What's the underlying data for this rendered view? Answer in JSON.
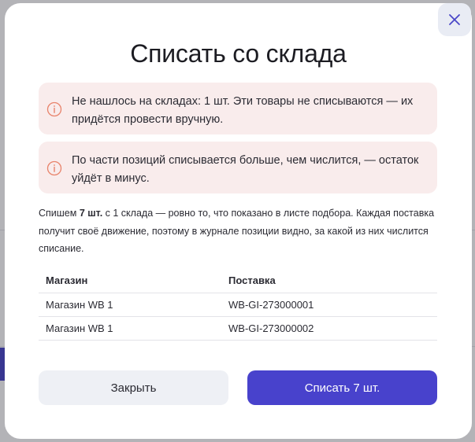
{
  "dialog": {
    "title": "Списать со склада",
    "alerts": [
      {
        "icon": "info-circle-icon",
        "text": "Не нашлось на складах: 1 шт. Эти товары не списываются — их придётся провести вручную."
      },
      {
        "icon": "info-circle-icon",
        "text": "По части позиций списывается больше, чем числится, — остаток уйдёт в минус."
      }
    ],
    "description": {
      "prefix": "Спишем ",
      "qty": "7 шт.",
      "rest": " с 1 склада — ровно то, что показано в листе подбора. Каждая поставка получит своё движение, поэтому в журнале позиции видно, за какой из них числится списание."
    },
    "table": {
      "columns": [
        "Магазин",
        "Поставка"
      ],
      "rows": [
        [
          "Магазин WB 1",
          "WB-GI-273000001"
        ],
        [
          "Магазин WB 1",
          "WB-GI-273000002"
        ]
      ]
    },
    "buttons": {
      "close_label": "Закрыть",
      "writeoff_label": "Списать 7 шт."
    },
    "close_icon": "close-icon"
  },
  "colors": {
    "accent": "#4842cc",
    "alert_bg": "#f9ecec",
    "alert_icon": "#e8836b",
    "secondary_button_bg": "#eef0f5"
  }
}
